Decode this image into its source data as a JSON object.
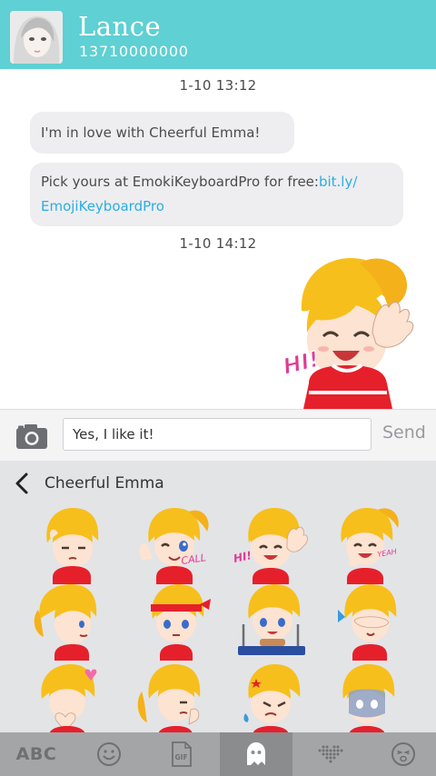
{
  "contact": {
    "name": "Lance",
    "phone": "13710000000"
  },
  "messages": [
    {
      "time": "1-10   13:12"
    },
    {
      "text": "I'm in love with Cheerful Emma!"
    },
    {
      "text_prefix": "Pick yours at EmokiKeyboardPro for free:",
      "link_line1": "bit.ly/",
      "link_line2": "EmojiKeyboardPro"
    },
    {
      "time": "1-10   14:12"
    }
  ],
  "sticker_large": {
    "caption": "HI!"
  },
  "composer": {
    "input_value": "Yes, I like it!",
    "send_label": "Send"
  },
  "sticker_panel": {
    "title": "Cheerful Emma",
    "captions": {
      "call": "CALL",
      "hi": "HI!",
      "yeah": "YEAH"
    }
  },
  "bottom_bar": {
    "abc_label": "ABC",
    "gif_label": "GIF",
    "active_tab": "ghost"
  },
  "colors": {
    "header": "#5fd0d3",
    "link": "#2aaee3",
    "hair": "#f7bf1c",
    "shirt": "#e6202b"
  }
}
